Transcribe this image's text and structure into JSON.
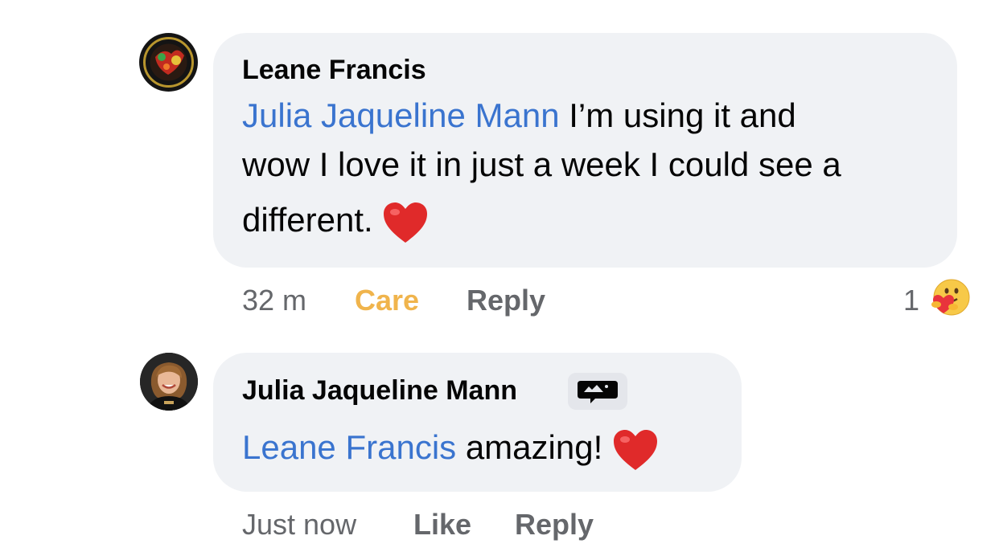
{
  "comments": [
    {
      "author": "Leane Francis",
      "mention": "Julia Jaqueline Mann",
      "text_line1": " I’m using it and",
      "text_line2": "wow I love it in just a week I could see a",
      "text_line3": "different.",
      "time": "32 m",
      "reaction_label": "Care",
      "reply_label": "Reply",
      "reaction_count": "1",
      "reaction_icon": "care-emoji-icon",
      "avatar_icon": "profile-photo-logo"
    },
    {
      "author": "Julia Jaqueline Mann",
      "author_badge_icon": "author-chat-badge-icon",
      "mention": "Leane Francis",
      "text": " amazing!",
      "time": "Just now",
      "like_label": "Like",
      "reply_label": "Reply",
      "avatar_icon": "profile-photo-woman"
    }
  ],
  "colors": {
    "bubble": "#f0f2f5",
    "mention": "#3a74cf",
    "meta": "#65676b",
    "care": "#f0b44c",
    "heart": "#e02a2a"
  }
}
